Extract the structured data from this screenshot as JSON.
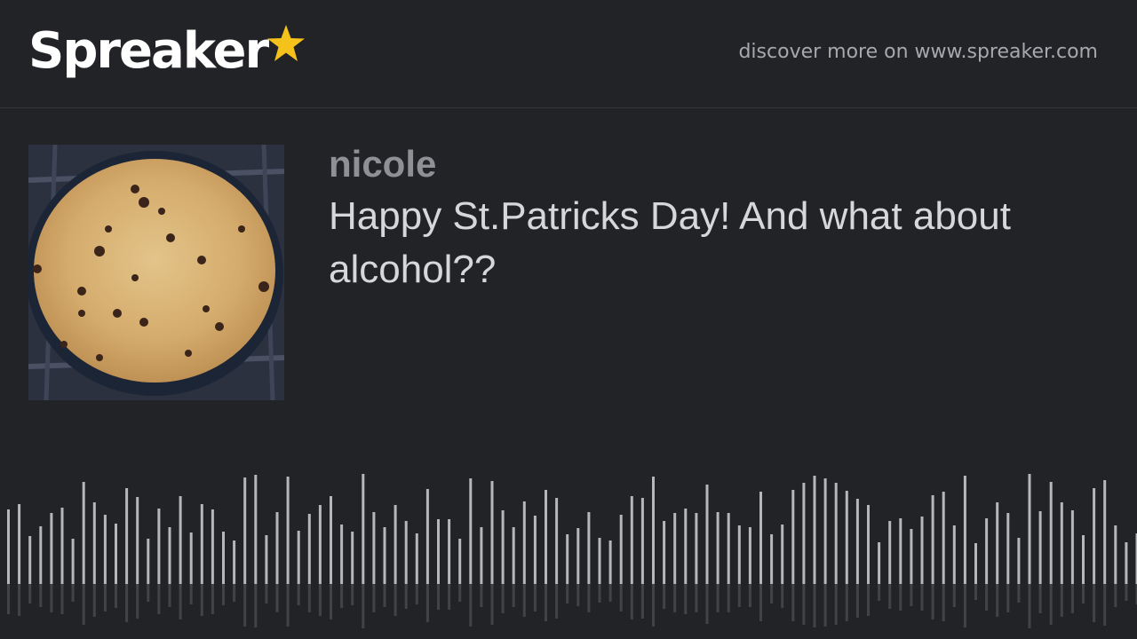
{
  "header": {
    "logo_text": "Spreaker",
    "logo_star_icon": "star-icon",
    "discover_text": "discover more on www.spreaker.com"
  },
  "episode": {
    "author": "nicole",
    "title": "Happy St.Patricks Day! And what about alcohol??",
    "cover_image": "cover-image"
  },
  "colors": {
    "background": "#222327",
    "star": "#f5c21b",
    "waveform_bar": "#b6b7ba",
    "author": "#8f9095",
    "title": "#d6d7da"
  }
}
